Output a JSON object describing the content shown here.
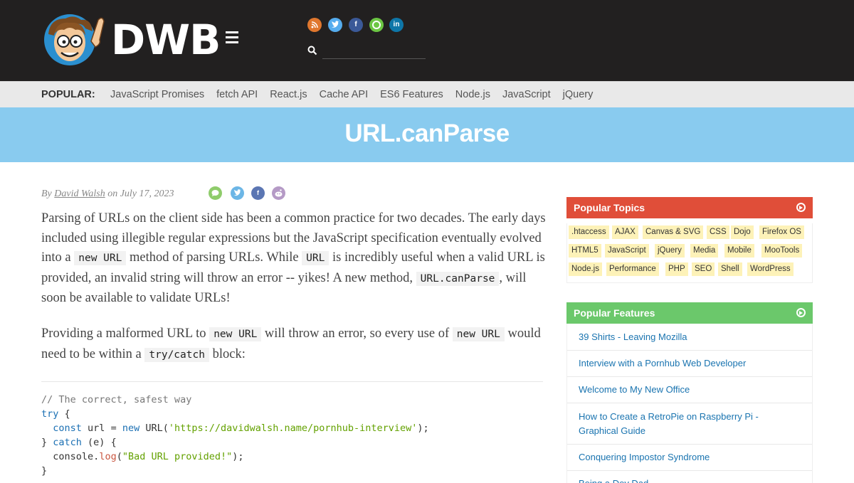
{
  "header": {
    "brand": "DWB",
    "social_icons": [
      {
        "icon": "rss-icon",
        "color": "#e0772e",
        "glyph": ")"
      },
      {
        "icon": "twitter-icon",
        "color": "#55acee",
        "glyph": "t"
      },
      {
        "icon": "facebook-icon",
        "color": "#3b5998",
        "glyph": "f"
      },
      {
        "icon": "github-icon",
        "color": "#6cc644",
        "glyph": "o"
      },
      {
        "icon": "linkedin-icon",
        "color": "#0e76a8",
        "glyph": "in"
      }
    ],
    "search": {
      "placeholder": "",
      "value": ""
    }
  },
  "popular": {
    "label": "POPULAR:",
    "links": [
      "JavaScript Promises",
      "fetch API",
      "React.js",
      "Cache API",
      "ES6 Features",
      "Node.js",
      "JavaScript",
      "jQuery"
    ]
  },
  "title": "URL.canParse",
  "byline": {
    "by": "By",
    "author": "David Walsh",
    "date": "on July 17, 2023"
  },
  "share_icons": [
    {
      "icon": "comment-icon",
      "color": "#8fcc6b"
    },
    {
      "icon": "twitter-icon",
      "color": "#6cb6e6"
    },
    {
      "icon": "facebook-icon",
      "color": "#5b76b3"
    },
    {
      "icon": "reddit-icon",
      "color": "#b59ac6"
    }
  ],
  "article": {
    "p1": {
      "t1": "Parsing of URLs on the client side has been a common practice for two decades. The early days included using illegible regular expressions but the JavaScript specification eventually evolved into a",
      "c1": "new URL",
      "t2": "method of parsing URLs. While",
      "c2": "URL",
      "t3": "is incredibly useful when a valid URL is provided, an invalid string will throw an error -- yikes! A new method,",
      "c3": "URL.canParse",
      "t4": ", will soon be available to validate URLs!"
    },
    "p2": {
      "t1": "Providing a malformed URL to",
      "c1": "new URL",
      "t2": "will throw an error, so every use of",
      "c2": "new URL",
      "t3": "would need to be within a",
      "c3": "try/catch",
      "t4": "block:"
    },
    "code": {
      "comment": "// The correct, safest way",
      "try": "try",
      "const": "const",
      "var": "url",
      "new": "new",
      "ctor": "URL",
      "url_str": "'https://davidwalsh.name/pornhub-interview'",
      "catch": "catch",
      "err": "(e)",
      "console": "console",
      "log": "log",
      "msg": "\"Bad URL provided!\""
    }
  },
  "sidebar": {
    "topics_title": "Popular Topics",
    "topics": [
      [
        ".htaccess",
        "AJAX",
        "Canvas & SVG",
        "CSS",
        "Dojo",
        "Firefox OS"
      ],
      [
        "HTML5",
        "JavaScript",
        "jQuery",
        "Media",
        "Mobile",
        "MooTools"
      ],
      [
        "Node.js",
        "Performance",
        "PHP",
        "SEO",
        "Shell",
        "WordPress"
      ]
    ],
    "features_title": "Popular Features",
    "features": [
      "39 Shirts - Leaving Mozilla",
      "Interview with a Pornhub Web Developer",
      "Welcome to My New Office",
      "How to Create a RetroPie on Raspberry Pi - Graphical Guide",
      "Conquering Impostor Syndrome",
      "Being a Dev Dad"
    ]
  }
}
